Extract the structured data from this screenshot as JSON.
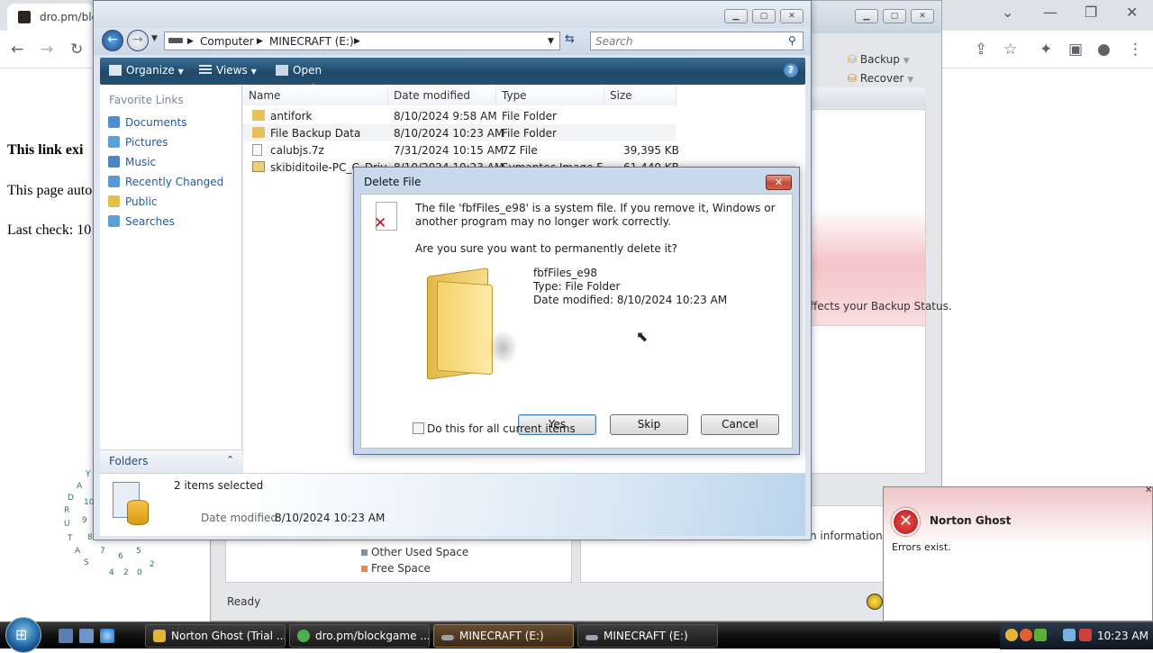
{
  "browser": {
    "tab_title": "dro.pm/blc",
    "page_lines": [
      "This link exi",
      "This page auto",
      "Last check: 10"
    ]
  },
  "norton": {
    "nav": [
      {
        "label": "Backup"
      },
      {
        "label": "Recover"
      }
    ],
    "red_panel_text": "ffects your Backup Status.",
    "info_text": "n information.",
    "legend": [
      {
        "label": "Other Used Space",
        "color": "#7f8fa6"
      },
      {
        "label": "Free Space",
        "color": "#e08a5a"
      }
    ],
    "status": "Ready"
  },
  "explorer": {
    "breadcrumb": [
      "Computer",
      "MINECRAFT (E:)"
    ],
    "search_placeholder": "Search",
    "commands": {
      "organize": "Organize",
      "views": "Views",
      "open": "Open"
    },
    "favorites_header": "Favorite Links",
    "favorites": [
      {
        "label": "Documents",
        "color": "#4f8fcf"
      },
      {
        "label": "Pictures",
        "color": "#5ca0d8"
      },
      {
        "label": "Music",
        "color": "#4a86c4"
      },
      {
        "label": "Recently Changed",
        "color": "#5a9ad4"
      },
      {
        "label": "Public",
        "color": "#e3c04a"
      },
      {
        "label": "Searches",
        "color": "#5f9fd2"
      }
    ],
    "folders_label": "Folders",
    "columns": [
      "Name",
      "Date modified",
      "Type",
      "Size"
    ],
    "files": [
      {
        "name": "antifork",
        "date": "8/10/2024 9:58 AM",
        "type": "File Folder",
        "size": "",
        "icon": "folder"
      },
      {
        "name": "File Backup Data",
        "date": "8/10/2024 10:23 AM",
        "type": "File Folder",
        "size": "",
        "icon": "folder"
      },
      {
        "name": "calubjs.7z",
        "date": "7/31/2024 10:15 AM",
        "type": "7Z File",
        "size": "39,395 KB",
        "icon": "file"
      },
      {
        "name": "skibiditoile-PC_C_Driv",
        "date": "8/10/2024 10:23 AM",
        "type": "Symantec Image F",
        "size": "61,440 KB",
        "icon": "image"
      }
    ],
    "details": {
      "count": "2 items selected",
      "label": "Date modified:",
      "value": "8/10/2024 10:23 AM"
    }
  },
  "dialog": {
    "title": "Delete File",
    "message1": "The file 'fbfFiles_e98' is a system file. If you remove it, Windows or another program may no longer work correctly.",
    "message2": "Are you sure you want to permanently delete it?",
    "file_name": "fbfFiles_e98",
    "file_type": "Type: File Folder",
    "file_date": "Date modified: 8/10/2024 10:23 AM",
    "buttons": {
      "yes": "Yes",
      "skip": "Skip",
      "cancel": "Cancel"
    },
    "checkbox_label": "Do this for all current items"
  },
  "toast": {
    "title": "Norton Ghost",
    "body": "Errors exist."
  },
  "gadget": {
    "letters": [
      "Y",
      "A",
      "D",
      "R",
      "U",
      "T",
      "A",
      "S"
    ],
    "numbers": [
      "10",
      "9",
      "8",
      "7",
      "6",
      "5",
      "4",
      "2",
      "0",
      "2"
    ]
  },
  "taskbar": {
    "tasks": [
      {
        "label": "Norton Ghost (Trial ...",
        "color": "#e3b63a",
        "active": false
      },
      {
        "label": "dro.pm/blockgame ...",
        "color": "#4caf50",
        "active": false
      },
      {
        "label": "MINECRAFT (E:)",
        "color": "#9aa3ad",
        "active": true
      },
      {
        "label": "MINECRAFT (E:)",
        "color": "#9aa3ad",
        "active": false
      }
    ],
    "clock": "10:23 AM"
  }
}
